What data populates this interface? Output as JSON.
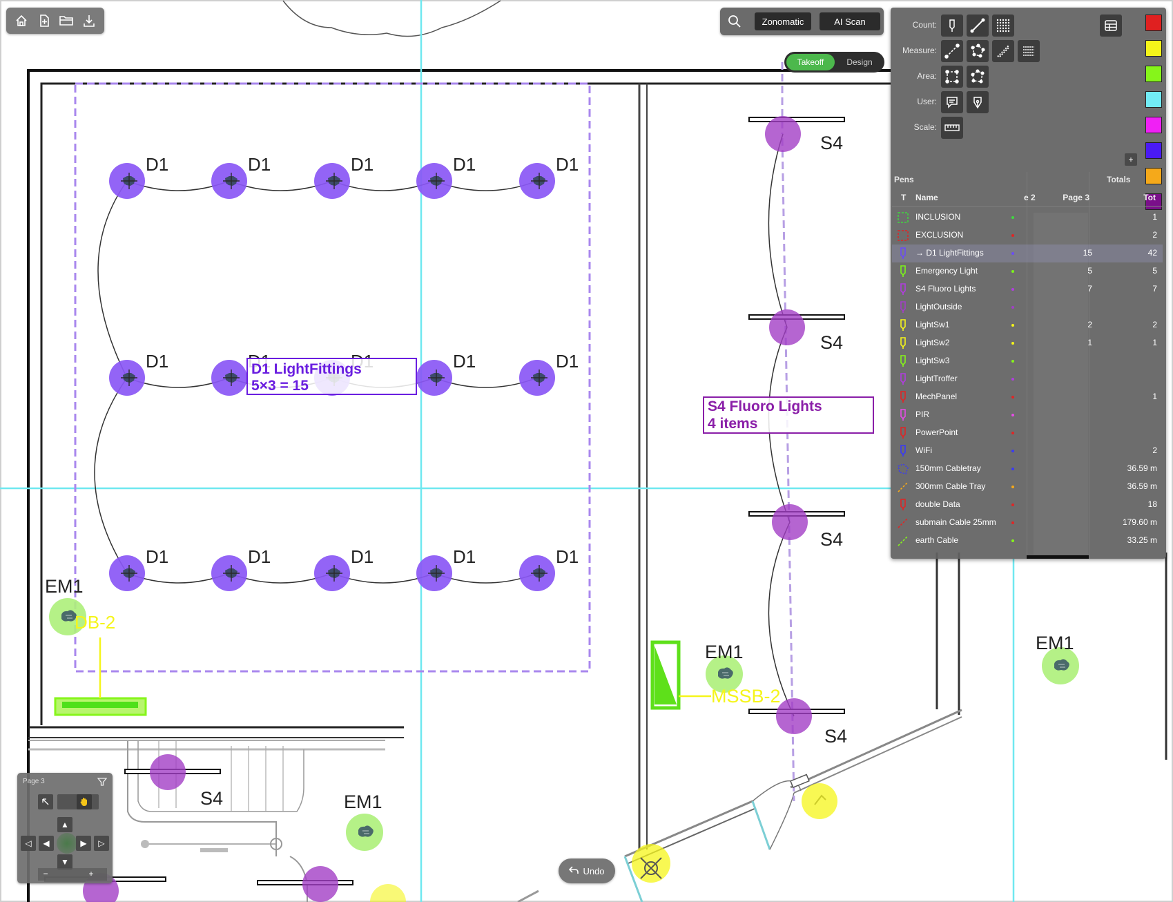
{
  "toolbar_left": {
    "icons": [
      "home-icon",
      "new-file-icon",
      "open-folder-icon",
      "download-icon"
    ]
  },
  "toolbar_top": {
    "search_icon": "search-icon",
    "zonomatic_label": "Zonomatic",
    "ai_scan_label": "AI Scan"
  },
  "mode_toggle": {
    "takeoff_label": "Takeoff",
    "design_label": "Design",
    "active": "Takeoff"
  },
  "tools": {
    "count_label": "Count:",
    "measure_label": "Measure:",
    "area_label": "Area:",
    "user_label": "User:",
    "scale_label": "Scale:",
    "count_icons": [
      "count-pin-icon",
      "count-line-icon",
      "count-grid-icon"
    ],
    "measure_icons": [
      "measure-line-icon",
      "measure-polyline-icon",
      "measure-dashed-icon",
      "measure-multi-icon"
    ],
    "area_icons": [
      "area-rect-icon",
      "area-polygon-icon"
    ],
    "user_icons": [
      "comment-icon",
      "pen-nib-icon"
    ],
    "scale_icons": [
      "ruler-icon"
    ],
    "table_icon": "table-icon",
    "add_color_label": "+",
    "colors": [
      "#e02020",
      "#f5f51a",
      "#86f51a",
      "#72ecf5",
      "#f020f5",
      "#4a1af5",
      "#f5a91a",
      "#7a0f8a"
    ]
  },
  "pens_panel": {
    "title": "Pens",
    "totals_title": "Totals",
    "col_type": "T",
    "col_name": "Name",
    "col_prev": "e 2",
    "col_page": "Page 3",
    "col_total": "Tot",
    "rows": [
      {
        "name": "INCLUSION",
        "page3": "",
        "total": "1",
        "color": "#3fd93f",
        "icon": "inclusion-area-icon",
        "selected": false
      },
      {
        "name": "EXCLUSION",
        "page3": "",
        "total": "2",
        "color": "#e02525",
        "icon": "exclusion-area-icon",
        "selected": false
      },
      {
        "name": "→ D1 LightFittings",
        "page3": "15",
        "total": "42",
        "color": "#6b4cf5",
        "icon": "count-pin-icon",
        "selected": true
      },
      {
        "name": "Emergency Light",
        "page3": "5",
        "total": "5",
        "color": "#7cf51a",
        "icon": "count-pin-icon",
        "selected": false
      },
      {
        "name": "S4 Fluoro Lights",
        "page3": "7",
        "total": "7",
        "color": "#b23ce0",
        "icon": "count-pin-icon",
        "selected": false
      },
      {
        "name": "LightOutside",
        "page3": "",
        "total": "",
        "color": "#a23ec6",
        "icon": "count-pin-icon",
        "selected": false
      },
      {
        "name": "LightSw1",
        "page3": "2",
        "total": "2",
        "color": "#f5f51a",
        "icon": "count-pin-icon",
        "selected": false
      },
      {
        "name": "LightSw2",
        "page3": "1",
        "total": "1",
        "color": "#f5f51a",
        "icon": "count-pin-icon",
        "selected": false
      },
      {
        "name": "LightSw3",
        "page3": "",
        "total": "",
        "color": "#86f51a",
        "icon": "count-pin-icon",
        "selected": false
      },
      {
        "name": "LightTroffer",
        "page3": "",
        "total": "",
        "color": "#b23ce0",
        "icon": "count-pin-icon",
        "selected": false
      },
      {
        "name": "MechPanel",
        "page3": "",
        "total": "1",
        "color": "#e02525",
        "icon": "count-pin-icon",
        "selected": false
      },
      {
        "name": "PIR",
        "page3": "",
        "total": "",
        "color": "#e64ce6",
        "icon": "count-pin-icon",
        "selected": false
      },
      {
        "name": "PowerPoint",
        "page3": "",
        "total": "",
        "color": "#e02525",
        "icon": "count-pin-icon",
        "selected": false
      },
      {
        "name": "WiFi",
        "page3": "",
        "total": "2",
        "color": "#3a3af5",
        "icon": "count-pin-icon",
        "selected": false
      },
      {
        "name": "150mm Cabletray",
        "page3": "",
        "total": "36.59 m",
        "color": "#3a3af5",
        "icon": "polyline-measure-icon",
        "selected": false
      },
      {
        "name": "300mm Cable Tray",
        "page3": "",
        "total": "36.59 m",
        "color": "#f5a91a",
        "icon": "line-measure-icon",
        "selected": false
      },
      {
        "name": "double Data",
        "page3": "",
        "total": "18",
        "color": "#e02525",
        "icon": "count-pin-icon",
        "selected": false
      },
      {
        "name": "submain Cable 25mm",
        "page3": "",
        "total": "179.60 m",
        "color": "#e02525",
        "icon": "line-measure-icon",
        "selected": false
      },
      {
        "name": "earth Cable",
        "page3": "",
        "total": "33.25 m",
        "color": "#86f51a",
        "icon": "line-measure-icon",
        "selected": false
      }
    ]
  },
  "navpad": {
    "page_label": "Page 3",
    "icons": [
      "filter-icon",
      "pointer-icon",
      "hand-icon",
      "arrow-up-icon",
      "arrow-left-end-icon",
      "arrow-left-icon",
      "arrow-right-icon",
      "arrow-right-end-icon",
      "arrow-down-icon"
    ],
    "zoom_out": "−",
    "zoom_in": "+"
  },
  "undo": {
    "label": "Undo",
    "icon": "undo-icon"
  },
  "drawing": {
    "d1_tag": "D1",
    "s4_tag": "S4",
    "em1_tag": "EM1",
    "db_tag": "DB-2",
    "mssb_tag": "MSSB-2",
    "d1_callout_line1": "D1 LightFittings",
    "d1_callout_line2": "5×3 = 15",
    "s4_callout_line1": "S4 Fluoro Lights",
    "s4_callout_line2": "4 items",
    "d1_color": "#8a57f5",
    "s4_color": "#a23ec6",
    "em_color": "#adf07a",
    "sw_color": "#f5f51a",
    "guide_color": "#6fe8f0"
  }
}
